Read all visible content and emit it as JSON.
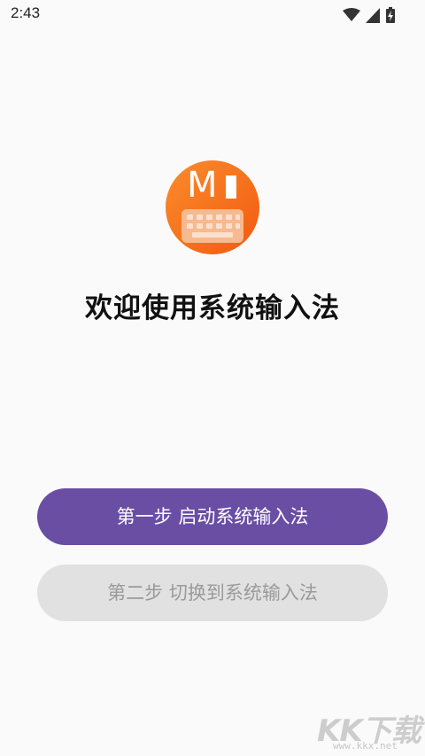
{
  "status_bar": {
    "time": "2:43",
    "icons": [
      "wifi-icon",
      "cellular-signal-icon",
      "battery-charging-icon"
    ]
  },
  "app": {
    "logo_letter": "M",
    "logo_color_start": "#fb8c2c",
    "logo_color_end": "#f25a10"
  },
  "welcome": {
    "title": "欢迎使用系统输入法"
  },
  "buttons": {
    "step1_label": "第一步 启动系统输入法",
    "step2_label": "第二步 切换到系统输入法",
    "step1_color": "#6a4ea4",
    "step2_color": "#e1e1e1"
  },
  "watermark": {
    "text": "KK下载",
    "url": "www.kkx.net"
  }
}
